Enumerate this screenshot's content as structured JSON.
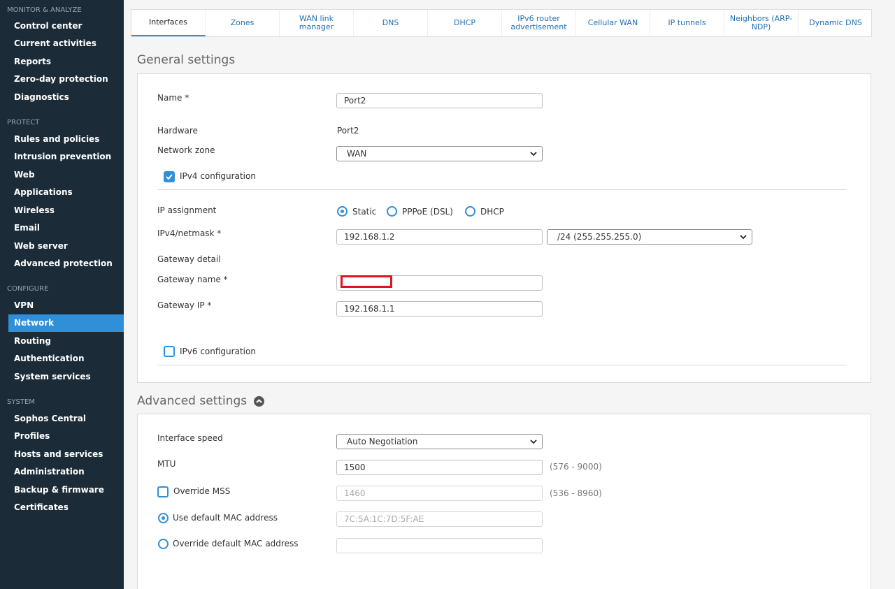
{
  "sidebar": {
    "sections": [
      {
        "title": "MONITOR & ANALYZE",
        "items": [
          "Control center",
          "Current activities",
          "Reports",
          "Zero-day protection",
          "Diagnostics"
        ]
      },
      {
        "title": "PROTECT",
        "items": [
          "Rules and policies",
          "Intrusion prevention",
          "Web",
          "Applications",
          "Wireless",
          "Email",
          "Web server",
          "Advanced protection"
        ]
      },
      {
        "title": "CONFIGURE",
        "items": [
          "VPN",
          "Network",
          "Routing",
          "Authentication",
          "System services"
        ]
      },
      {
        "title": "SYSTEM",
        "items": [
          "Sophos Central",
          "Profiles",
          "Hosts and services",
          "Administration",
          "Backup & firmware",
          "Certificates"
        ]
      }
    ],
    "active_item": "Network"
  },
  "tabs": [
    "Interfaces",
    "Zones",
    "WAN link manager",
    "DNS",
    "DHCP",
    "IPv6 router advertisement",
    "Cellular WAN",
    "IP tunnels",
    "Neighbors (ARP-NDP)",
    "Dynamic DNS"
  ],
  "active_tab": "Interfaces",
  "general": {
    "title": "General settings",
    "name_label": "Name *",
    "name_value": "Port2",
    "hardware_label": "Hardware",
    "hardware_value": "Port2",
    "zone_label": "Network zone",
    "zone_value": "WAN",
    "ipv4_config_label": "IPv4 configuration",
    "ipv4_config_checked": true,
    "ip_assignment_label": "IP assignment",
    "ip_assignment_options": [
      "Static",
      "PPPoE (DSL)",
      "DHCP"
    ],
    "ip_assignment_selected": "Static",
    "ipv4_netmask_label": "IPv4/netmask *",
    "ipv4_value": "192.168.1.2",
    "netmask_value": "/24 (255.255.255.0)",
    "gateway_detail_label": "Gateway detail",
    "gateway_name_label": "Gateway name *",
    "gateway_name_value": "",
    "gateway_ip_label": "Gateway IP *",
    "gateway_ip_value": "192.168.1.1",
    "ipv6_config_label": "IPv6 configuration",
    "ipv6_config_checked": false
  },
  "advanced": {
    "title": "Advanced settings",
    "speed_label": "Interface speed",
    "speed_value": "Auto Negotiation",
    "mtu_label": "MTU",
    "mtu_value": "1500",
    "mtu_range": "(576 - 9000)",
    "override_mss_label": "Override MSS",
    "override_mss_checked": false,
    "mss_value": "1460",
    "mss_range": "(536 - 8960)",
    "use_default_mac_label": "Use default MAC address",
    "default_mac_value": "7C:5A:1C:7D:5F:AE",
    "override_mac_label": "Override default MAC address",
    "override_mac_value": "",
    "mac_selected": "Use default MAC address"
  },
  "colors": {
    "sidebar_bg": "#1b2b38",
    "accent": "#2f8fd8",
    "highlight": "#e0141e"
  }
}
